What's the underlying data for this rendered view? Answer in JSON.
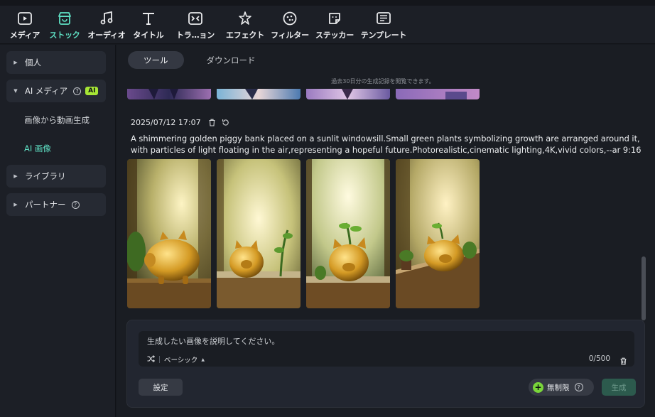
{
  "toolbar": {
    "items": [
      {
        "label": "メディア",
        "icon": "media-icon"
      },
      {
        "label": "ストック",
        "icon": "stock-icon",
        "active": true
      },
      {
        "label": "オーディオ",
        "icon": "audio-icon"
      },
      {
        "label": "タイトル",
        "icon": "title-icon"
      },
      {
        "label": "トラ…ョン",
        "icon": "transition-icon"
      },
      {
        "label": "エフェクト",
        "icon": "effect-icon"
      },
      {
        "label": "フィルター",
        "icon": "filter-icon"
      },
      {
        "label": "ステッカー",
        "icon": "sticker-icon"
      },
      {
        "label": "テンプレート",
        "icon": "template-icon"
      }
    ]
  },
  "sidebar": {
    "personal": "個人",
    "ai_media": "AI メディア",
    "ai_badge": "AI",
    "image_to_video": "画像から動画生成",
    "ai_image": "AI 画像",
    "library": "ライブラリ",
    "partner": "パートナー"
  },
  "tabs": {
    "tools": "ツール",
    "downloads": "ダウンロード"
  },
  "history_hint": "過去30日分の生成記録を閲覧できます。",
  "generation": {
    "datetime": "2025/07/12 17:07",
    "prompt": "A shimmering golden piggy bank placed on a sunlit windowsill.Small green plants symbolizing growth are arranged around it, with particles of light floating in the air,representing a hopeful future.Photorealistic,cinematic lighting,4K,vivid colors,--ar 9:16"
  },
  "input": {
    "placeholder": "生成したい画像を説明してください。",
    "mode": "ベーシック",
    "counter": "0/500"
  },
  "buttons": {
    "settings": "設定",
    "unlimited": "無制限",
    "generate": "生成"
  },
  "colors": {
    "accent": "#5fe0c4",
    "ai_badge": "#a6e635",
    "generate_disabled": "#2c5a4d"
  }
}
